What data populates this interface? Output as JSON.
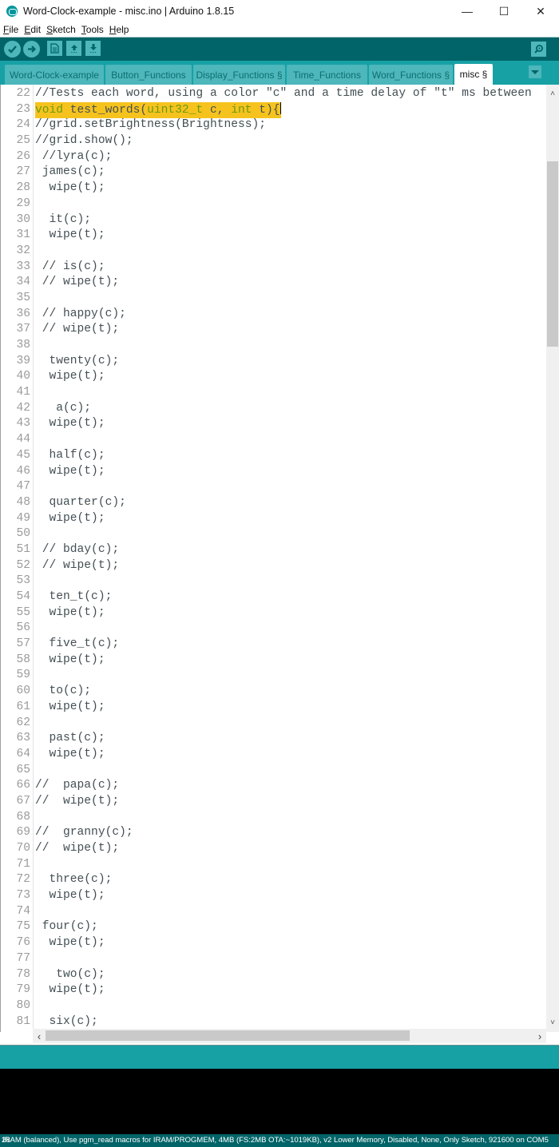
{
  "window": {
    "title": "Word-Clock-example - misc.ino | Arduino 1.8.15",
    "controls": {
      "minimize": "—",
      "maximize": "☐",
      "close": "✕"
    }
  },
  "menu": [
    {
      "underline": "F",
      "rest": "ile"
    },
    {
      "underline": "E",
      "rest": "dit"
    },
    {
      "underline": "S",
      "rest": "ketch"
    },
    {
      "underline": "T",
      "rest": "ools"
    },
    {
      "underline": "H",
      "rest": "elp"
    }
  ],
  "toolbar": {
    "buttons": [
      {
        "name": "verify",
        "icon": "✔"
      },
      {
        "name": "upload",
        "icon": "➜"
      },
      {
        "name": "new",
        "icon": "🗎"
      },
      {
        "name": "open",
        "icon": "⬆"
      },
      {
        "name": "save",
        "icon": "⬇"
      }
    ],
    "serial_monitor_icon": "magnifier"
  },
  "tabs": [
    {
      "label": "Word-Clock-example",
      "active": false
    },
    {
      "label": "Button_Functions",
      "active": false
    },
    {
      "label": "Display_Functions §",
      "active": false
    },
    {
      "label": "Time_Functions",
      "active": false
    },
    {
      "label": "Word_Functions §",
      "active": false
    },
    {
      "label": "misc §",
      "active": true
    }
  ],
  "editor": {
    "highlighted_line": 23,
    "lines": [
      {
        "n": "22",
        "text": "//Tests each word, using a color \"c\" and a time delay of \"t\" ms between"
      },
      {
        "n": "23",
        "text": "void test_words(uint32_t c, int t){"
      },
      {
        "n": "24",
        "text": "//grid.setBrightness(Brightness);"
      },
      {
        "n": "25",
        "text": "//grid.show();"
      },
      {
        "n": "26",
        "text": " //lyra(c);"
      },
      {
        "n": "27",
        "text": " james(c);"
      },
      {
        "n": "28",
        "text": "  wipe(t);"
      },
      {
        "n": "29",
        "text": ""
      },
      {
        "n": "30",
        "text": "  it(c);"
      },
      {
        "n": "31",
        "text": "  wipe(t);"
      },
      {
        "n": "32",
        "text": ""
      },
      {
        "n": "33",
        "text": " // is(c);"
      },
      {
        "n": "34",
        "text": " // wipe(t);"
      },
      {
        "n": "35",
        "text": ""
      },
      {
        "n": "36",
        "text": " // happy(c);"
      },
      {
        "n": "37",
        "text": " // wipe(t);"
      },
      {
        "n": "38",
        "text": ""
      },
      {
        "n": "39",
        "text": "  twenty(c);"
      },
      {
        "n": "40",
        "text": "  wipe(t);"
      },
      {
        "n": "41",
        "text": ""
      },
      {
        "n": "42",
        "text": "   a(c);"
      },
      {
        "n": "43",
        "text": "  wipe(t);"
      },
      {
        "n": "44",
        "text": ""
      },
      {
        "n": "45",
        "text": "  half(c);"
      },
      {
        "n": "46",
        "text": "  wipe(t);"
      },
      {
        "n": "47",
        "text": ""
      },
      {
        "n": "48",
        "text": "  quarter(c);"
      },
      {
        "n": "49",
        "text": "  wipe(t);"
      },
      {
        "n": "50",
        "text": ""
      },
      {
        "n": "51",
        "text": " // bday(c);"
      },
      {
        "n": "52",
        "text": " // wipe(t);"
      },
      {
        "n": "53",
        "text": ""
      },
      {
        "n": "54",
        "text": "  ten_t(c);"
      },
      {
        "n": "55",
        "text": "  wipe(t);"
      },
      {
        "n": "56",
        "text": ""
      },
      {
        "n": "57",
        "text": "  five_t(c);"
      },
      {
        "n": "58",
        "text": "  wipe(t);"
      },
      {
        "n": "59",
        "text": ""
      },
      {
        "n": "60",
        "text": "  to(c);"
      },
      {
        "n": "61",
        "text": "  wipe(t);"
      },
      {
        "n": "62",
        "text": ""
      },
      {
        "n": "63",
        "text": "  past(c);"
      },
      {
        "n": "64",
        "text": "  wipe(t);"
      },
      {
        "n": "65",
        "text": ""
      },
      {
        "n": "66",
        "text": "//  papa(c);"
      },
      {
        "n": "67",
        "text": "//  wipe(t);"
      },
      {
        "n": "68",
        "text": ""
      },
      {
        "n": "69",
        "text": "//  granny(c);"
      },
      {
        "n": "70",
        "text": "//  wipe(t);"
      },
      {
        "n": "71",
        "text": ""
      },
      {
        "n": "72",
        "text": "  three(c);"
      },
      {
        "n": "73",
        "text": "  wipe(t);"
      },
      {
        "n": "74",
        "text": ""
      },
      {
        "n": "75",
        "text": " four(c);"
      },
      {
        "n": "76",
        "text": "  wipe(t);"
      },
      {
        "n": "77",
        "text": ""
      },
      {
        "n": "78",
        "text": "   two(c);"
      },
      {
        "n": "79",
        "text": "  wipe(t);"
      },
      {
        "n": "80",
        "text": ""
      },
      {
        "n": "81",
        "text": "  six(c);"
      }
    ],
    "vscroll_up": "˄",
    "vscroll_down": "˅",
    "hscroll_left": "‹",
    "hscroll_right": "›"
  },
  "colors": {
    "teal_dark": "#006468",
    "teal_mid": "#17a1a5",
    "teal_light": "#4db7bb",
    "highlight": "#f6c31e",
    "keyword": "#6c9a10"
  },
  "status": {
    "line_number": "28",
    "board_info": "IRAM (balanced), Use pgm_read macros for IRAM/PROGMEM, 4MB (FS:2MB OTA:~1019KB), v2 Lower Memory, Disabled, None, Only Sketch, 921600 on COM5"
  }
}
